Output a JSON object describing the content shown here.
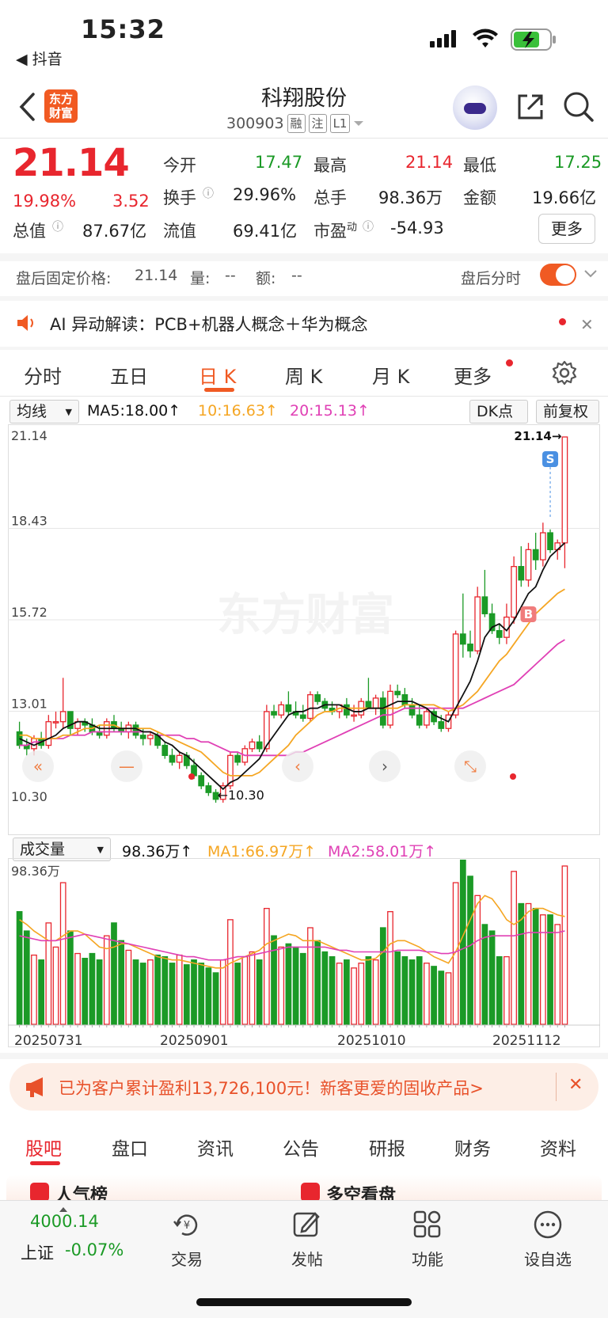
{
  "status_bar": {
    "time": "15:32",
    "back_app": "◀ 抖音"
  },
  "header": {
    "title": "科翔股份",
    "code": "300903",
    "tags": [
      "融",
      "注",
      "L1"
    ],
    "logo_text": "东方财富"
  },
  "quote": {
    "price": "21.14",
    "change_pct": "19.98%",
    "change": "3.52",
    "rows": [
      [
        {
          "label": "今开",
          "value": "17.47",
          "color": "green"
        },
        {
          "label": "最高",
          "value": "21.14",
          "color": "red"
        },
        {
          "label": "最低",
          "value": "17.25",
          "color": "green"
        }
      ],
      [
        {
          "label": "换手",
          "value": "29.96%",
          "color": "black"
        },
        {
          "label": "总手",
          "value": "98.36万",
          "color": "black"
        },
        {
          "label": "金额",
          "value": "19.66亿",
          "color": "black"
        }
      ]
    ],
    "total_value_label": "总值",
    "total_value": "87.67亿",
    "float_value_label": "流值",
    "float_value": "69.41亿",
    "pe_label": "市盈",
    "pe_sup": "动",
    "pe_value": "-54.93",
    "more_label": "更多"
  },
  "after_hours": {
    "label": "盘后固定价格:",
    "price": "21.14",
    "vol_label": "量:",
    "vol": "--",
    "amt_label": "额:",
    "amt": "--",
    "right_label": "盘后分时"
  },
  "ai_alert": {
    "text": "AI 异动解读：PCB+机器人概念＋华为概念"
  },
  "chart_tabs": [
    "分时",
    "五日",
    "日 K",
    "周 K",
    "月 K",
    "更多"
  ],
  "ma_bar": {
    "selector": "均线",
    "ma5": "MA5:18.00",
    "ma10": "10:16.63",
    "ma20": "20:15.13",
    "dk": "DK点",
    "adjust": "前复权"
  },
  "volume_bar": {
    "selector": "成交量",
    "vol": "98.36万",
    "ma1": "MA1:66.97万",
    "ma2": "MA2:58.01万"
  },
  "chart_data": {
    "type": "candlestick",
    "y_ticks": [
      "21.14",
      "18.43",
      "15.72",
      "13.01",
      "10.30"
    ],
    "ylim": [
      10.3,
      21.14
    ],
    "annotations": {
      "high": "21.14→",
      "low": "←10.30",
      "sell": "S",
      "buy": "B"
    },
    "watermark": "东方财富",
    "x_labels": [
      "20250731",
      "20250901",
      "20251010",
      "20251112"
    ],
    "volume_ylim_label": "98.36万",
    "candles": [
      [
        12.4,
        12.7,
        11.9,
        12.0,
        70
      ],
      [
        12.0,
        12.2,
        11.7,
        11.9,
        58
      ],
      [
        11.9,
        12.3,
        11.7,
        12.2,
        43
      ],
      [
        12.2,
        12.4,
        11.9,
        12.0,
        40
      ],
      [
        12.0,
        12.9,
        11.9,
        12.7,
        63
      ],
      [
        12.7,
        13.0,
        12.5,
        12.7,
        48
      ],
      [
        12.7,
        14.0,
        12.5,
        13.0,
        88
      ],
      [
        13.0,
        13.0,
        12.3,
        12.5,
        58
      ],
      [
        12.5,
        12.8,
        12.3,
        12.7,
        44
      ],
      [
        12.7,
        12.8,
        12.4,
        12.6,
        41
      ],
      [
        12.6,
        12.8,
        12.3,
        12.4,
        44
      ],
      [
        12.4,
        12.6,
        12.2,
        12.3,
        40
      ],
      [
        12.3,
        12.8,
        12.2,
        12.7,
        55
      ],
      [
        12.7,
        12.9,
        12.4,
        12.5,
        63
      ],
      [
        12.5,
        12.7,
        12.3,
        12.4,
        52
      ],
      [
        12.4,
        12.7,
        12.2,
        12.6,
        46
      ],
      [
        12.6,
        12.7,
        12.2,
        12.3,
        40
      ],
      [
        12.3,
        12.5,
        12.0,
        12.2,
        38
      ],
      [
        12.2,
        12.4,
        12.0,
        12.3,
        40
      ],
      [
        12.3,
        12.4,
        11.9,
        12.0,
        43
      ],
      [
        12.0,
        12.1,
        11.6,
        11.7,
        42
      ],
      [
        11.7,
        11.9,
        11.4,
        11.5,
        38
      ],
      [
        11.5,
        11.8,
        11.3,
        11.7,
        43
      ],
      [
        11.7,
        11.8,
        11.3,
        11.4,
        37
      ],
      [
        11.4,
        11.6,
        11.0,
        11.1,
        40
      ],
      [
        11.1,
        11.2,
        10.7,
        10.8,
        38
      ],
      [
        10.8,
        10.9,
        10.5,
        10.6,
        35
      ],
      [
        10.6,
        10.7,
        10.3,
        10.4,
        32
      ],
      [
        10.4,
        10.9,
        10.3,
        10.8,
        40
      ],
      [
        10.8,
        11.8,
        10.7,
        11.7,
        65
      ],
      [
        11.7,
        11.8,
        11.4,
        11.5,
        38
      ],
      [
        11.5,
        12.0,
        11.4,
        11.9,
        42
      ],
      [
        11.9,
        12.2,
        11.8,
        12.1,
        45
      ],
      [
        12.1,
        12.3,
        11.8,
        11.9,
        40
      ],
      [
        11.9,
        13.2,
        11.8,
        13.0,
        72
      ],
      [
        13.0,
        13.2,
        12.8,
        12.9,
        55
      ],
      [
        12.9,
        13.3,
        12.8,
        13.2,
        48
      ],
      [
        13.2,
        13.6,
        12.9,
        13.0,
        50
      ],
      [
        13.0,
        13.3,
        12.8,
        12.9,
        48
      ],
      [
        12.9,
        13.2,
        12.7,
        12.8,
        44
      ],
      [
        12.8,
        13.6,
        12.7,
        13.5,
        60
      ],
      [
        13.5,
        13.6,
        13.2,
        13.3,
        52
      ],
      [
        13.3,
        13.4,
        13.0,
        13.1,
        45
      ],
      [
        13.1,
        13.3,
        12.9,
        13.0,
        42
      ],
      [
        13.0,
        13.2,
        12.8,
        13.2,
        38
      ],
      [
        13.2,
        13.4,
        12.8,
        12.9,
        40
      ],
      [
        12.9,
        13.2,
        12.7,
        12.9,
        35
      ],
      [
        12.9,
        13.4,
        12.8,
        13.3,
        38
      ],
      [
        13.3,
        14.0,
        13.2,
        13.1,
        42
      ],
      [
        13.1,
        13.5,
        12.9,
        13.4,
        40
      ],
      [
        13.4,
        13.6,
        12.5,
        12.6,
        60
      ],
      [
        12.6,
        13.8,
        12.5,
        13.6,
        70
      ],
      [
        13.6,
        13.8,
        13.4,
        13.5,
        45
      ],
      [
        13.5,
        13.7,
        13.1,
        13.2,
        42
      ],
      [
        13.2,
        13.4,
        12.8,
        12.9,
        40
      ],
      [
        12.9,
        13.2,
        12.5,
        12.6,
        42
      ],
      [
        12.6,
        13.1,
        12.5,
        13.0,
        38
      ],
      [
        13.0,
        13.1,
        12.6,
        12.7,
        36
      ],
      [
        12.7,
        12.9,
        12.4,
        12.5,
        33
      ],
      [
        12.5,
        13.0,
        12.4,
        12.9,
        32
      ],
      [
        12.9,
        15.4,
        12.8,
        15.3,
        88
      ],
      [
        15.3,
        16.5,
        14.6,
        15.0,
        102
      ],
      [
        15.0,
        15.4,
        14.6,
        14.8,
        92
      ],
      [
        14.8,
        16.7,
        14.7,
        16.4,
        80
      ],
      [
        16.4,
        17.2,
        15.8,
        15.9,
        62
      ],
      [
        15.9,
        16.2,
        15.3,
        15.4,
        58
      ],
      [
        15.4,
        15.6,
        15.0,
        15.2,
        42
      ],
      [
        15.2,
        16.2,
        15.0,
        15.8,
        42
      ],
      [
        15.8,
        17.6,
        15.6,
        17.3,
        95
      ],
      [
        17.3,
        17.9,
        16.7,
        16.9,
        75
      ],
      [
        16.9,
        18.0,
        16.7,
        17.8,
        75
      ],
      [
        17.8,
        18.3,
        17.2,
        17.5,
        72
      ],
      [
        17.5,
        18.6,
        17.3,
        18.3,
        68
      ],
      [
        18.3,
        18.4,
        17.7,
        17.8,
        68
      ],
      [
        17.8,
        18.1,
        17.5,
        18.0,
        62
      ],
      [
        18.0,
        21.14,
        17.25,
        21.14,
        98.36
      ]
    ],
    "ma5": [
      12.2,
      12.1,
      12.0,
      12.1,
      12.2,
      12.3,
      12.5,
      12.6,
      12.7,
      12.7,
      12.6,
      12.5,
      12.5,
      12.5,
      12.5,
      12.5,
      12.5,
      12.4,
      12.4,
      12.3,
      12.1,
      12.0,
      11.8,
      11.7,
      11.5,
      11.3,
      11.1,
      10.9,
      10.7,
      10.9,
      11.0,
      11.2,
      11.4,
      11.6,
      12.0,
      12.3,
      12.6,
      12.9,
      13.0,
      13.0,
      13.1,
      13.1,
      13.2,
      13.2,
      13.2,
      13.1,
      13.0,
      13.0,
      13.1,
      13.1,
      13.1,
      13.2,
      13.3,
      13.3,
      13.3,
      13.2,
      13.1,
      12.9,
      12.8,
      12.7,
      13.1,
      13.5,
      13.9,
      14.5,
      15.2,
      15.5,
      15.6,
      15.4,
      15.7,
      16.1,
      16.5,
      16.7,
      17.2,
      17.6,
      17.8,
      18.0
    ],
    "ma10": [
      12.3,
      12.3,
      12.2,
      12.2,
      12.2,
      12.2,
      12.3,
      12.3,
      12.4,
      12.5,
      12.5,
      12.6,
      12.6,
      12.6,
      12.5,
      12.5,
      12.5,
      12.5,
      12.5,
      12.4,
      12.3,
      12.2,
      12.1,
      12.0,
      11.9,
      11.8,
      11.6,
      11.4,
      11.2,
      11.1,
      11.1,
      11.1,
      11.1,
      11.2,
      11.4,
      11.6,
      11.8,
      12.0,
      12.3,
      12.5,
      12.7,
      12.9,
      13.0,
      13.0,
      13.1,
      13.1,
      13.1,
      13.1,
      13.1,
      13.1,
      13.1,
      13.1,
      13.1,
      13.2,
      13.2,
      13.2,
      13.2,
      13.2,
      13.1,
      13.0,
      13.1,
      13.2,
      13.4,
      13.6,
      13.9,
      14.2,
      14.5,
      14.7,
      15.0,
      15.3,
      15.6,
      15.9,
      16.1,
      16.3,
      16.5,
      16.63
    ],
    "ma20": [
      12.0,
      12.0,
      12.1,
      12.1,
      12.2,
      12.2,
      12.2,
      12.3,
      12.3,
      12.3,
      12.4,
      12.4,
      12.4,
      12.4,
      12.4,
      12.4,
      12.4,
      12.4,
      12.4,
      12.3,
      12.3,
      12.3,
      12.3,
      12.2,
      12.2,
      12.1,
      12.1,
      12.0,
      11.9,
      11.8,
      11.8,
      11.7,
      11.7,
      11.7,
      11.7,
      11.7,
      11.7,
      11.7,
      11.8,
      11.8,
      11.9,
      12.0,
      12.1,
      12.2,
      12.3,
      12.4,
      12.5,
      12.6,
      12.7,
      12.8,
      12.9,
      12.9,
      13.0,
      13.1,
      13.1,
      13.1,
      13.1,
      13.1,
      13.1,
      13.1,
      13.1,
      13.1,
      13.2,
      13.3,
      13.4,
      13.5,
      13.6,
      13.7,
      13.8,
      14.0,
      14.2,
      14.4,
      14.6,
      14.8,
      15.0,
      15.13
    ],
    "vol_ma1": [
      65,
      62,
      58,
      55,
      52,
      52,
      55,
      58,
      58,
      56,
      52,
      48,
      47,
      48,
      50,
      50,
      48,
      46,
      44,
      42,
      41,
      40,
      40,
      39,
      38,
      37,
      36,
      35,
      35,
      38,
      40,
      42,
      44,
      46,
      50,
      52,
      54,
      56,
      55,
      52,
      52,
      52,
      50,
      48,
      46,
      44,
      42,
      40,
      40,
      41,
      45,
      50,
      52,
      52,
      50,
      48,
      45,
      42,
      40,
      38,
      45,
      55,
      65,
      75,
      80,
      78,
      72,
      65,
      62,
      65,
      70,
      72,
      72,
      70,
      68,
      66.97
    ],
    "vol_ma2": [
      55,
      54,
      53,
      52,
      52,
      52,
      53,
      54,
      55,
      56,
      55,
      54,
      53,
      52,
      51,
      50,
      49,
      48,
      47,
      46,
      45,
      44,
      43,
      42,
      42,
      41,
      40,
      40,
      40,
      41,
      42,
      42,
      43,
      44,
      45,
      46,
      47,
      48,
      48,
      48,
      48,
      48,
      48,
      47,
      46,
      46,
      45,
      45,
      45,
      45,
      45,
      45,
      46,
      46,
      46,
      46,
      45,
      45,
      44,
      44,
      45,
      47,
      49,
      52,
      54,
      55,
      55,
      55,
      55,
      56,
      57,
      57,
      57,
      57,
      57,
      58.01
    ]
  },
  "promo": {
    "text": "已为客户累计盈利13,726,100元！新客更爱的固收产品>"
  },
  "bottom_tabs": [
    "股吧",
    "盘口",
    "资讯",
    "公告",
    "研报",
    "财务",
    "资料"
  ],
  "peek": {
    "left": "人气榜",
    "right": "多空看盘"
  },
  "nav": {
    "index_value": "4000.14",
    "index_name": "上证",
    "index_change": "-0.07%",
    "items": [
      {
        "label": "交易",
        "icon": "trade-icon"
      },
      {
        "label": "发帖",
        "icon": "post-icon"
      },
      {
        "label": "功能",
        "icon": "grid-icon"
      },
      {
        "label": "设自选",
        "icon": "more-icon"
      }
    ]
  },
  "colors": {
    "up": "#e8262e",
    "down": "#1b9a26",
    "accent": "#f05a23",
    "ma5": "#111111",
    "ma10": "#f5a623",
    "ma20": "#e040b5"
  }
}
